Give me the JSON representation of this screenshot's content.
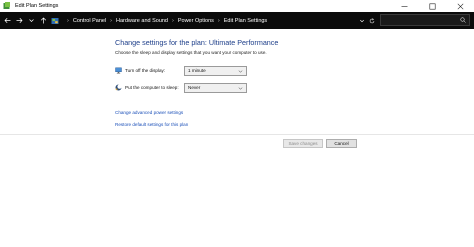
{
  "window": {
    "title": "Edit Plan Settings",
    "controls": [
      "minimize",
      "maximize",
      "close"
    ]
  },
  "addressbar": {
    "breadcrumbs": [
      "Control Panel",
      "Hardware and Sound",
      "Power Options",
      "Edit Plan Settings"
    ],
    "search_placeholder": ""
  },
  "main": {
    "heading": "Change settings for the plan: Ultimate Performance",
    "subtitle": "Choose the sleep and display settings that you want your computer to use.",
    "settings": [
      {
        "label": "Turn off the display:",
        "value": "1 minute",
        "icon": "monitor-icon"
      },
      {
        "label": "Put the computer to sleep:",
        "value": "Never",
        "icon": "moon-sleep-icon"
      }
    ],
    "links": {
      "advanced": "Change advanced power settings",
      "restore": "Restore default settings for this plan"
    }
  },
  "footer": {
    "save_label": "Save changes",
    "cancel_label": "Cancel"
  },
  "colors": {
    "heading": "#1e3f8a",
    "link": "#1a4fb8",
    "addressbar_bg": "#0b0b0b"
  }
}
